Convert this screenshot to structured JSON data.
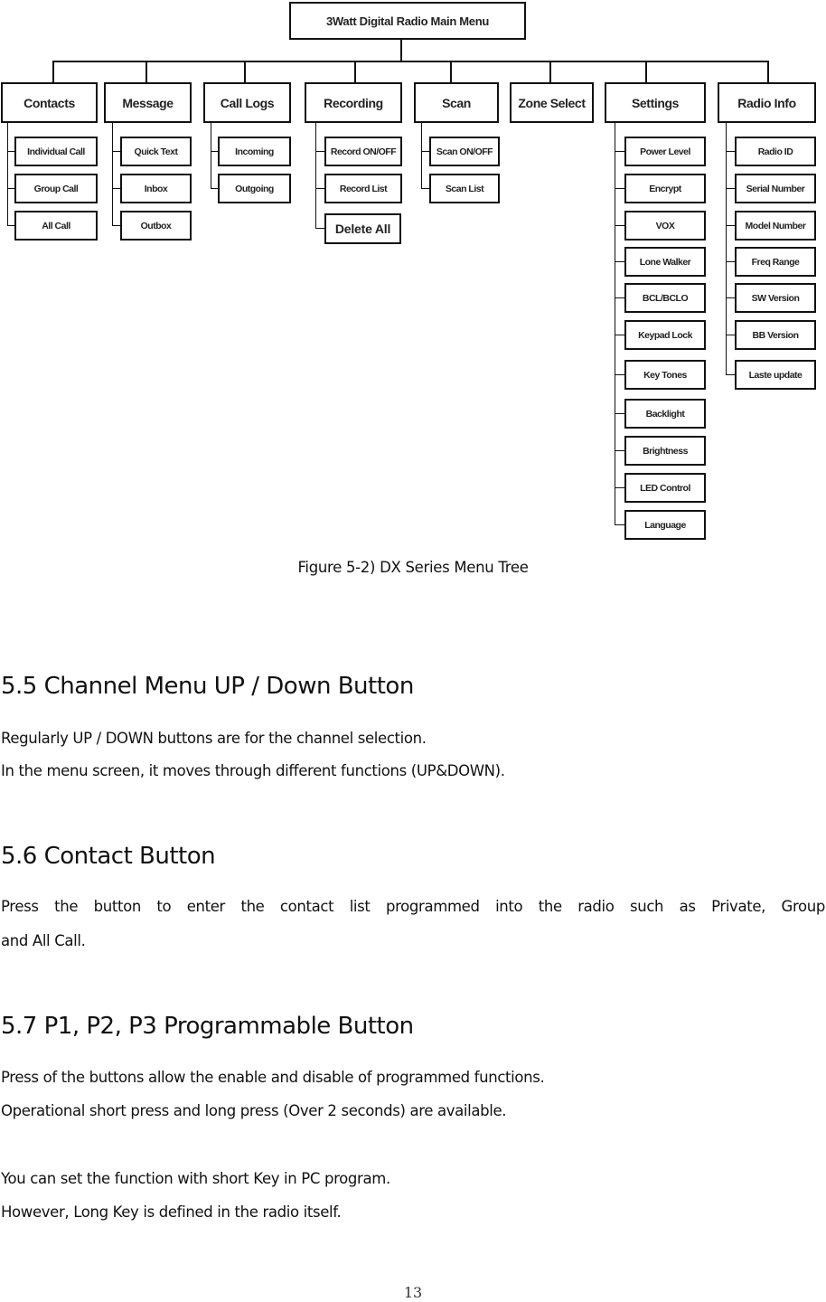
{
  "diagram": {
    "root": "3Watt Digital Radio Main Menu",
    "menus": [
      {
        "label": "Contacts",
        "items": [
          "Individual Call",
          "Group Call",
          "All Call"
        ]
      },
      {
        "label": "Message",
        "items": [
          "Quick Text",
          "Inbox",
          "Outbox"
        ]
      },
      {
        "label": "Call Logs",
        "items": [
          "Incoming",
          "Outgoing"
        ]
      },
      {
        "label": "Recording",
        "items": [
          "Record ON/OFF",
          "Record List",
          "Delete All"
        ]
      },
      {
        "label": "Scan",
        "items": [
          "Scan ON/OFF",
          "Scan List"
        ]
      },
      {
        "label": "Zone Select",
        "items": []
      },
      {
        "label": "Settings",
        "items": [
          "Power Level",
          "Encrypt",
          "VOX",
          "Lone Walker",
          "BCL/BCLO",
          "Keypad Lock",
          "Key Tones",
          "Backlight",
          "Brightness",
          "LED Control",
          "Language"
        ]
      },
      {
        "label": "Radio Info",
        "items": [
          "Radio ID",
          "Serial Number",
          "Model Number",
          "Freq Range",
          "SW Version",
          "BB Version",
          "Laste update"
        ]
      }
    ],
    "caption": "Figure 5-2) DX Series Menu Tree"
  },
  "sections": [
    {
      "heading": "5.5 Channel Menu UP / Down Button",
      "paragraphs": [
        "Regularly UP / DOWN buttons are for the channel selection.",
        "In the menu screen, it moves through different functions (UP&DOWN)."
      ]
    },
    {
      "heading": "5.6 Contact Button",
      "paragraphs": [
        "Press the button to enter the contact list programmed into the radio such as Private, Group",
        "and All Call."
      ]
    },
    {
      "heading": "5.7 P1, P2, P3 Programmable Button",
      "paragraphs": [
        "Press of the buttons allow the enable and disable of programmed functions.",
        "Operational short press and long press (Over 2 seconds) are available.",
        "You can set the function with short Key in PC program.",
        "However, Long Key is defined in the radio itself."
      ]
    }
  ],
  "page_number": "13"
}
